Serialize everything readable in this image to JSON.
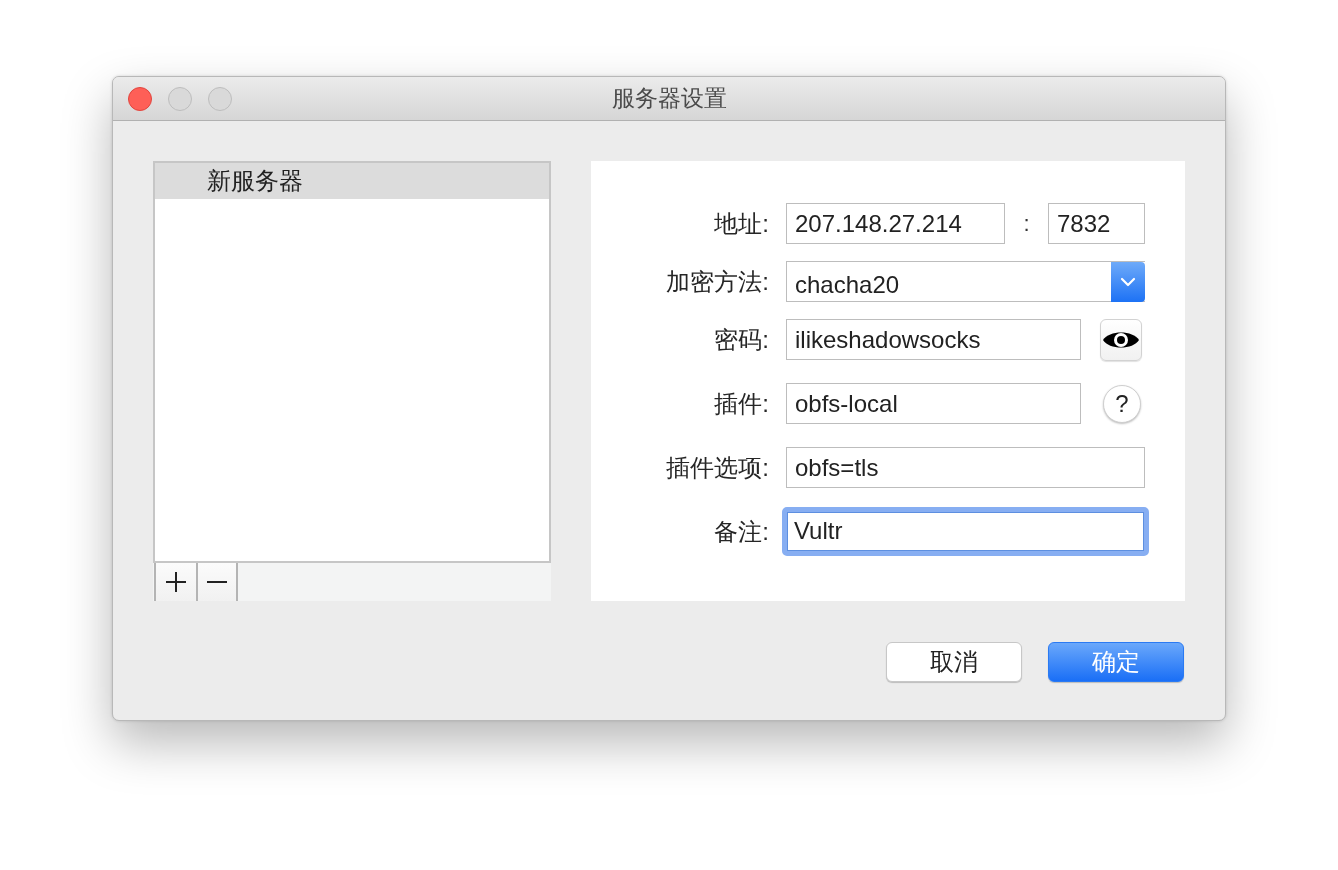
{
  "window": {
    "title": "服务器设置",
    "buttons": [
      {
        "kind": "close",
        "disabled": false
      },
      {
        "kind": "minimize",
        "disabled": true
      },
      {
        "kind": "zoom",
        "disabled": true
      }
    ]
  },
  "server_list": {
    "items": [
      {
        "label": "新服务器",
        "selected": true
      }
    ],
    "toolbar": [
      {
        "kind": "add"
      },
      {
        "kind": "remove"
      }
    ]
  },
  "form": {
    "rows": [
      {
        "kind": "address",
        "label": "地址:",
        "value": "207.148.27.214",
        "separator": ":",
        "port": "7832",
        "focused": false
      },
      {
        "kind": "select",
        "label": "加密方法:",
        "value": "chacha20",
        "focused": false
      },
      {
        "kind": "text",
        "label": "密码:",
        "value": "ilikeshadowsocks",
        "focused": false,
        "accessory": {
          "kind": "reveal"
        }
      },
      {
        "kind": "text",
        "label": "插件:",
        "value": "obfs-local",
        "focused": false,
        "accessory": {
          "kind": "help",
          "label": "?"
        }
      },
      {
        "kind": "text",
        "label": "插件选项:",
        "value": "obfs=tls",
        "focused": false
      },
      {
        "kind": "text",
        "label": "备注:",
        "value": "Vultr",
        "focused": true
      }
    ]
  },
  "buttons": [
    {
      "label": "取消",
      "default": false
    },
    {
      "label": "确定",
      "default": true
    }
  ]
}
